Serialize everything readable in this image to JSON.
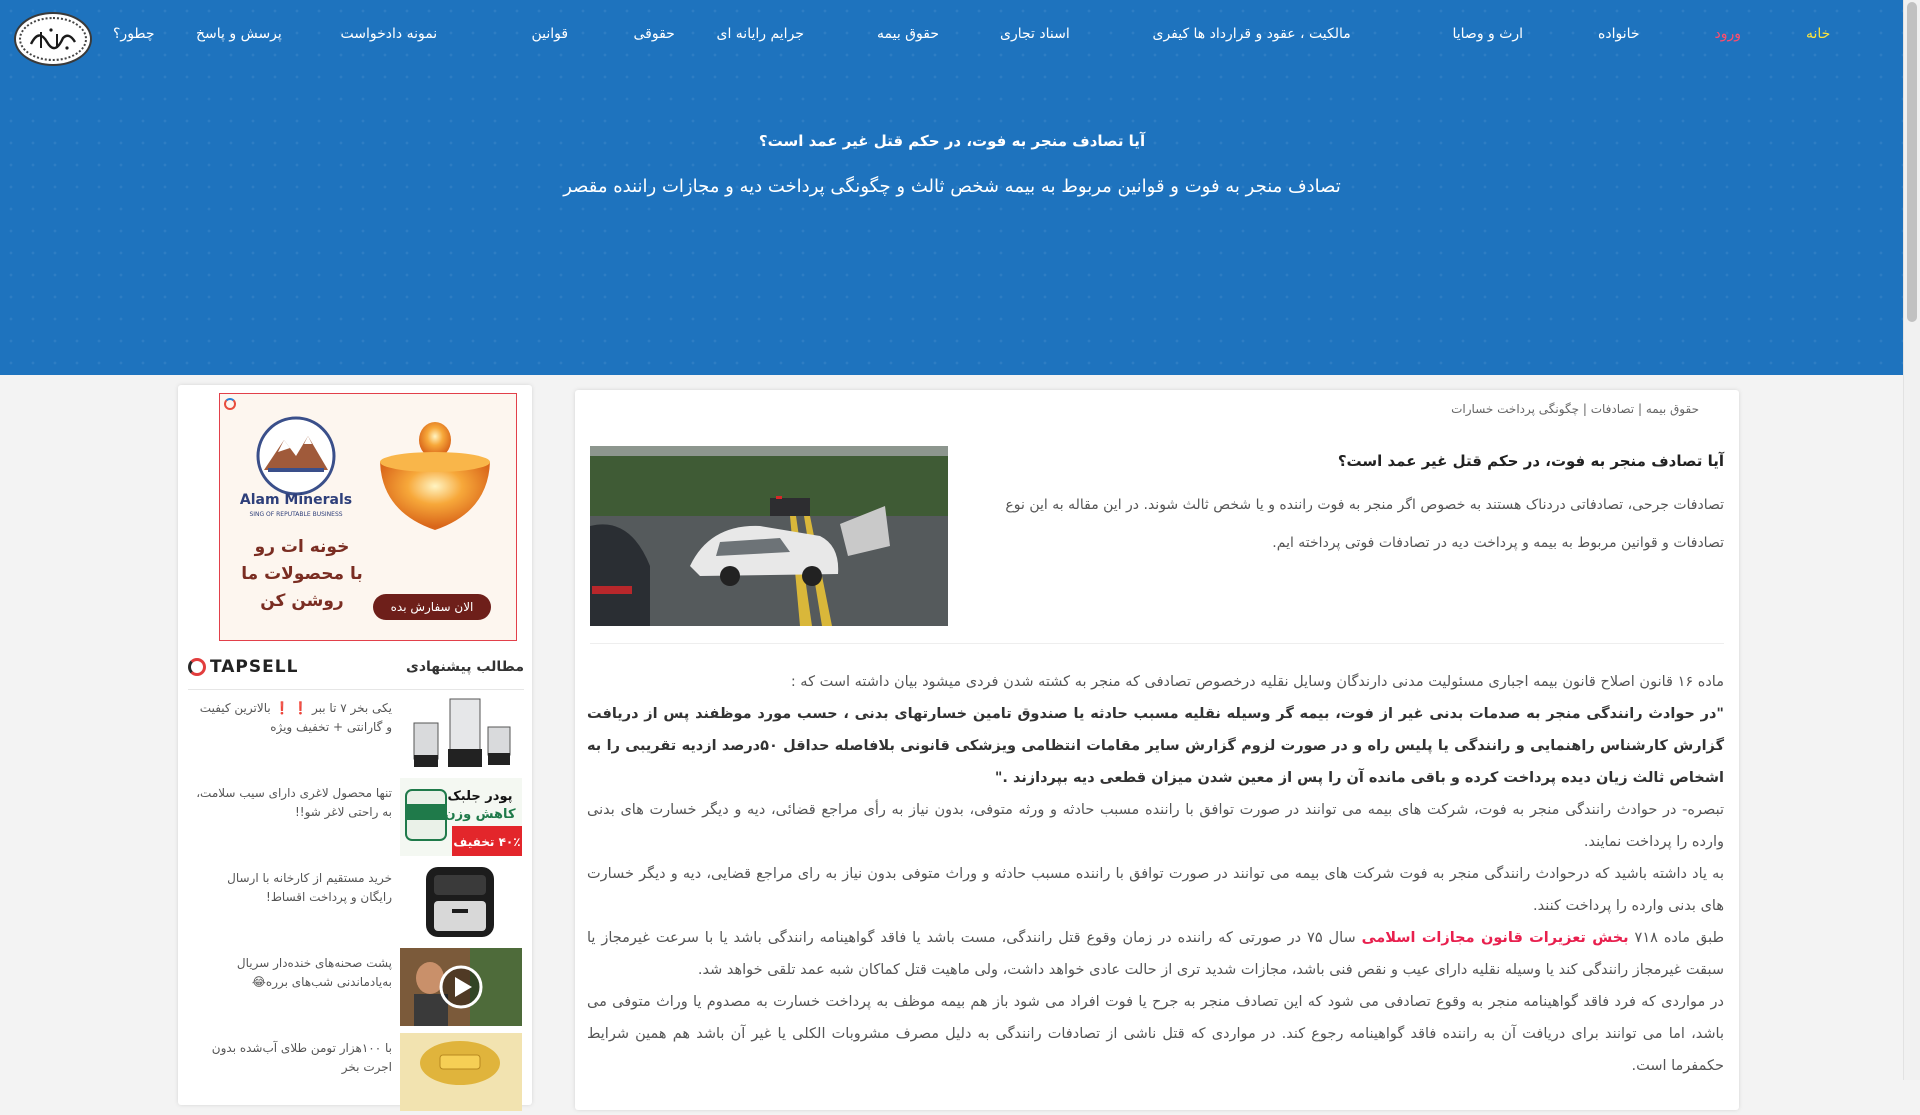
{
  "site": {
    "logo_alt": "logo-emblem"
  },
  "nav": {
    "home": "خانه",
    "login": "ورود",
    "family": "خانواده",
    "inheritance": "ارث و وصایا",
    "property": "مالکیت ، عقود و قرارداد ها",
    "criminal": "کیفری",
    "commercial": "اسناد تجاری",
    "insurance": "حقوق بیمه",
    "cyber": "جرایم رایانه ای",
    "civil": "حقوقی",
    "laws": "قوانین",
    "petition": "نمونه دادخواست",
    "qa": "پرسش و پاسخ",
    "howto": "چطور؟"
  },
  "hero": {
    "title": "آیا تصادف منجر به فوت، در حکم قتل غیر عمد است؟",
    "subtitle": "تصادف منجر به فوت و قوانین مربوط به بیمه شخص ثالث و چگونگی پرداخت دیه و مجازات راننده مقصر"
  },
  "breadcrumb": {
    "item1": "حقوق بیمه",
    "sep": "|",
    "item2": "تصادفات",
    "item3": "چگونگی پرداخت خسارات"
  },
  "article": {
    "title": "آیا تصادف منجر به فوت، در حکم قتل غیر عمد است؟",
    "intro": "تصادفات جرحی، تصادفاتی دردناک هستند به خصوص اگر منجر به فوت راننده و یا شخص ثالث شوند. در این مقاله به این نوع تصادفات و قوانین مربوط به بیمه و پرداخت دیه در تصادفات فوتی پرداخته ایم.",
    "p1": "ماده ۱۶ قانون اصلاح قانون بیمه اجباری مسئولیت مدنی دارندگان وسایل نقلیه درخصوص تصادفی که منجر به کشته شدن فردی میشود بیان داشته است که :",
    "quote": "\"در حوادث رانندگی منجر به صدمات بدنی غیر از فوت، بیمه گر وسیله نقلیه مسبب حادثه یا صندوق تامین خسارتهای بدنی ، حسب مورد موظفند پس از دریافت گزارش کارشناس راهنمایی و رانندگی یا پلیس راه و در صورت لزوم گزارش سایر مقامات انتظامی ویزشکی قانونی بلافاصله حداقل ۵۰درصد ازدیه تقریبی را به اشخاص ثالث زیان دیده پرداخت کرده و باقی مانده آن را پس از معین شدن میزان قطعی دیه بپردازند .\"",
    "p2": "تبصره- در حوادث رانندگی منجر به فوت، شرکت های بیمه می توانند در صورت توافق با راننده مسبب حادثه و ورثه متوفی، بدون نیاز به رأی مراجع قضائی، دیه و دیگر خسارت های بدنی وارده را پرداخت نمایند.",
    "p3": "به یاد داشته باشید که درحوادث رانندگی منجر به فوت شرکت های بیمه می توانند در صورت توافق با راننده مسبب حادثه و وراث متوفی بدون نیاز به رای مراجع قضایی، دیه و دیگر خسارت های بدنی وارده را پرداخت کنند.",
    "p4_before": "طبق ماده ۷۱۸",
    "p4_link": "بخش تعزیرات قانون مجازات اسلامی",
    "p4_after": "سال ۷۵ در صورتی که راننده در زمان وقوع قتل رانندگی، مست باشد یا فاقد گواهینامه رانندگی باشد یا با سرعت غیرمجاز یا سبقت غیرمجاز رانندگی کند یا وسیله نقلیه دارای عیب و نقص فنی باشد، مجازات شدید تری از حالت عادی خواهد داشت، ولی ماهیت قتل کماکان شبه عمد تلقی خواهد شد.",
    "p5": "در مواردی که فرد فاقد گواهینامه منجر به وقوع تصادفی می شود که این تصادف منجر به جرح یا فوت افراد می شود باز هم بیمه موظف به پرداخت خسارت به مصدوم یا وراث متوفی می باشد، اما می توانند برای دریافت آن به راننده فاقد گواهینامه رجوع کند. در مواردی که قتل ناشی از تصادفات رانندگی به دلیل مصرف مشروبات الکلی یا غیر آن باشد هم همین شرایط حکمفرما است."
  },
  "sidebar": {
    "ad": {
      "brand": "Alam Minerals",
      "brand_sub": "SING OF REPUTABLE BUSINESS",
      "line1": "خونه ات رو",
      "line2": "با محصولات ما",
      "line3": "روشن کن",
      "cta": "الان سفارش بده"
    },
    "rec_title": "مطالب پیشنهادی",
    "rec_brand": "TAPSELL",
    "items": [
      {
        "text": "یکی بخر ۷ تا ببر ❗ ❗ بالاترین کیفیت و گارانتی + تخفیف ویژه"
      },
      {
        "text": "تنها محصول لاغری دارای سیب سلامت، به راحتی لاغر شو!!",
        "thumb_l1": "پودر جلبک",
        "thumb_l2": "کاهش وزن",
        "thumb_badge": "۴۰٪ تخفیف"
      },
      {
        "text": "خرید مستقیم از کارخانه با ارسال رایگان و پرداخت اقساط!"
      },
      {
        "text": "پشت صحنه‌های خنده‌دار سریال به‌یادماندنی شب‌های برره😂"
      },
      {
        "text": "با ۱۰۰هزار تومن طلای آب‌شده بدون اجرت بخر"
      }
    ]
  }
}
